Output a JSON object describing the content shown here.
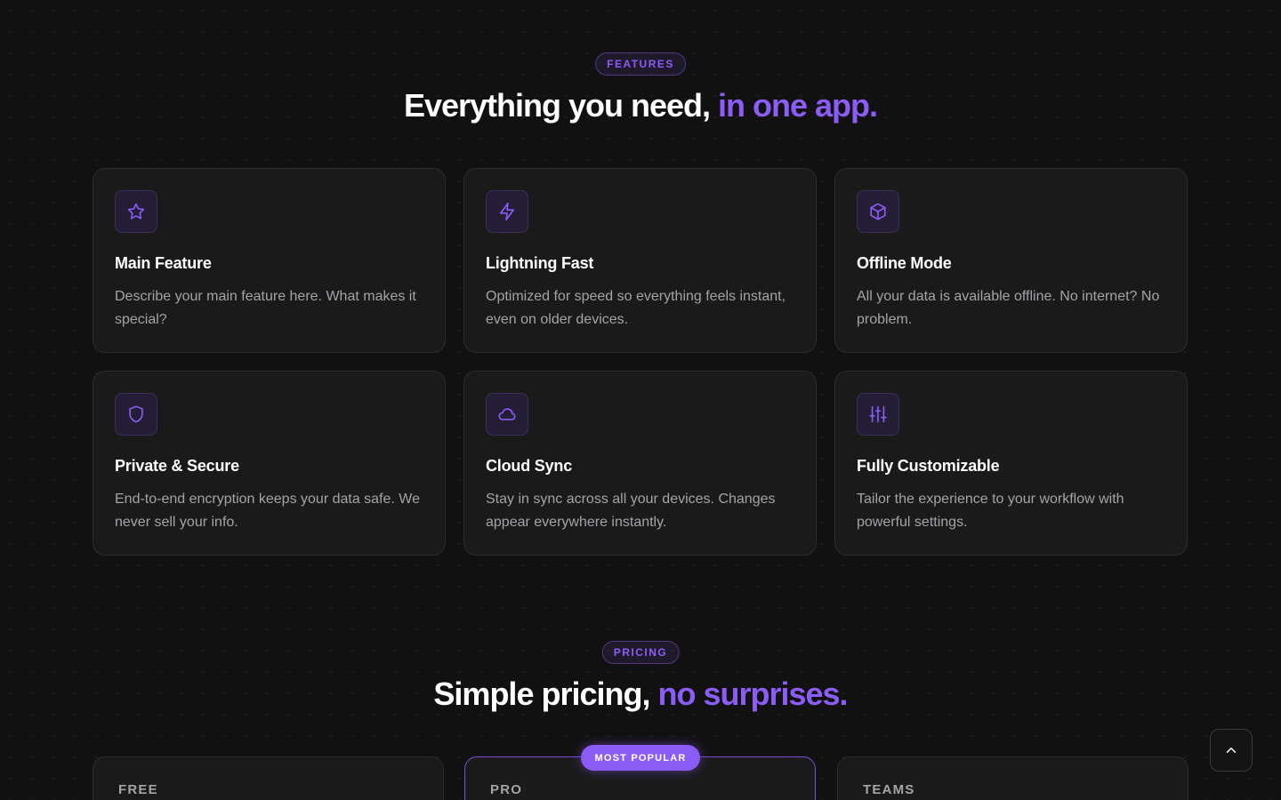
{
  "features": {
    "pill": "FEATURES",
    "title_main": "Everything you need,",
    "title_accent": "in one app.",
    "cards": [
      {
        "icon": "star-icon",
        "title": "Main Feature",
        "desc": "Describe your main feature here. What makes it special?"
      },
      {
        "icon": "lightning-icon",
        "title": "Lightning Fast",
        "desc": "Optimized for speed so everything feels instant, even on older devices."
      },
      {
        "icon": "cube-icon",
        "title": "Offline Mode",
        "desc": "All your data is available offline. No internet? No problem."
      },
      {
        "icon": "shield-icon",
        "title": "Private & Secure",
        "desc": "End-to-end encryption keeps your data safe. We never sell your info."
      },
      {
        "icon": "cloud-icon",
        "title": "Cloud Sync",
        "desc": "Stay in sync across all your devices. Changes appear everywhere instantly."
      },
      {
        "icon": "sliders-icon",
        "title": "Fully Customizable",
        "desc": "Tailor the experience to your workflow with powerful settings."
      }
    ]
  },
  "pricing": {
    "pill": "PRICING",
    "title_main": "Simple pricing,",
    "title_accent": "no surprises.",
    "badge": "MOST POPULAR",
    "plans": [
      {
        "name": "FREE"
      },
      {
        "name": "PRO"
      },
      {
        "name": "TEAMS"
      }
    ]
  },
  "colors": {
    "accent": "#8b5cf6",
    "background": "#111111",
    "card": "#1a1a1b"
  },
  "scroll_top_icon": "chevron-up-icon"
}
